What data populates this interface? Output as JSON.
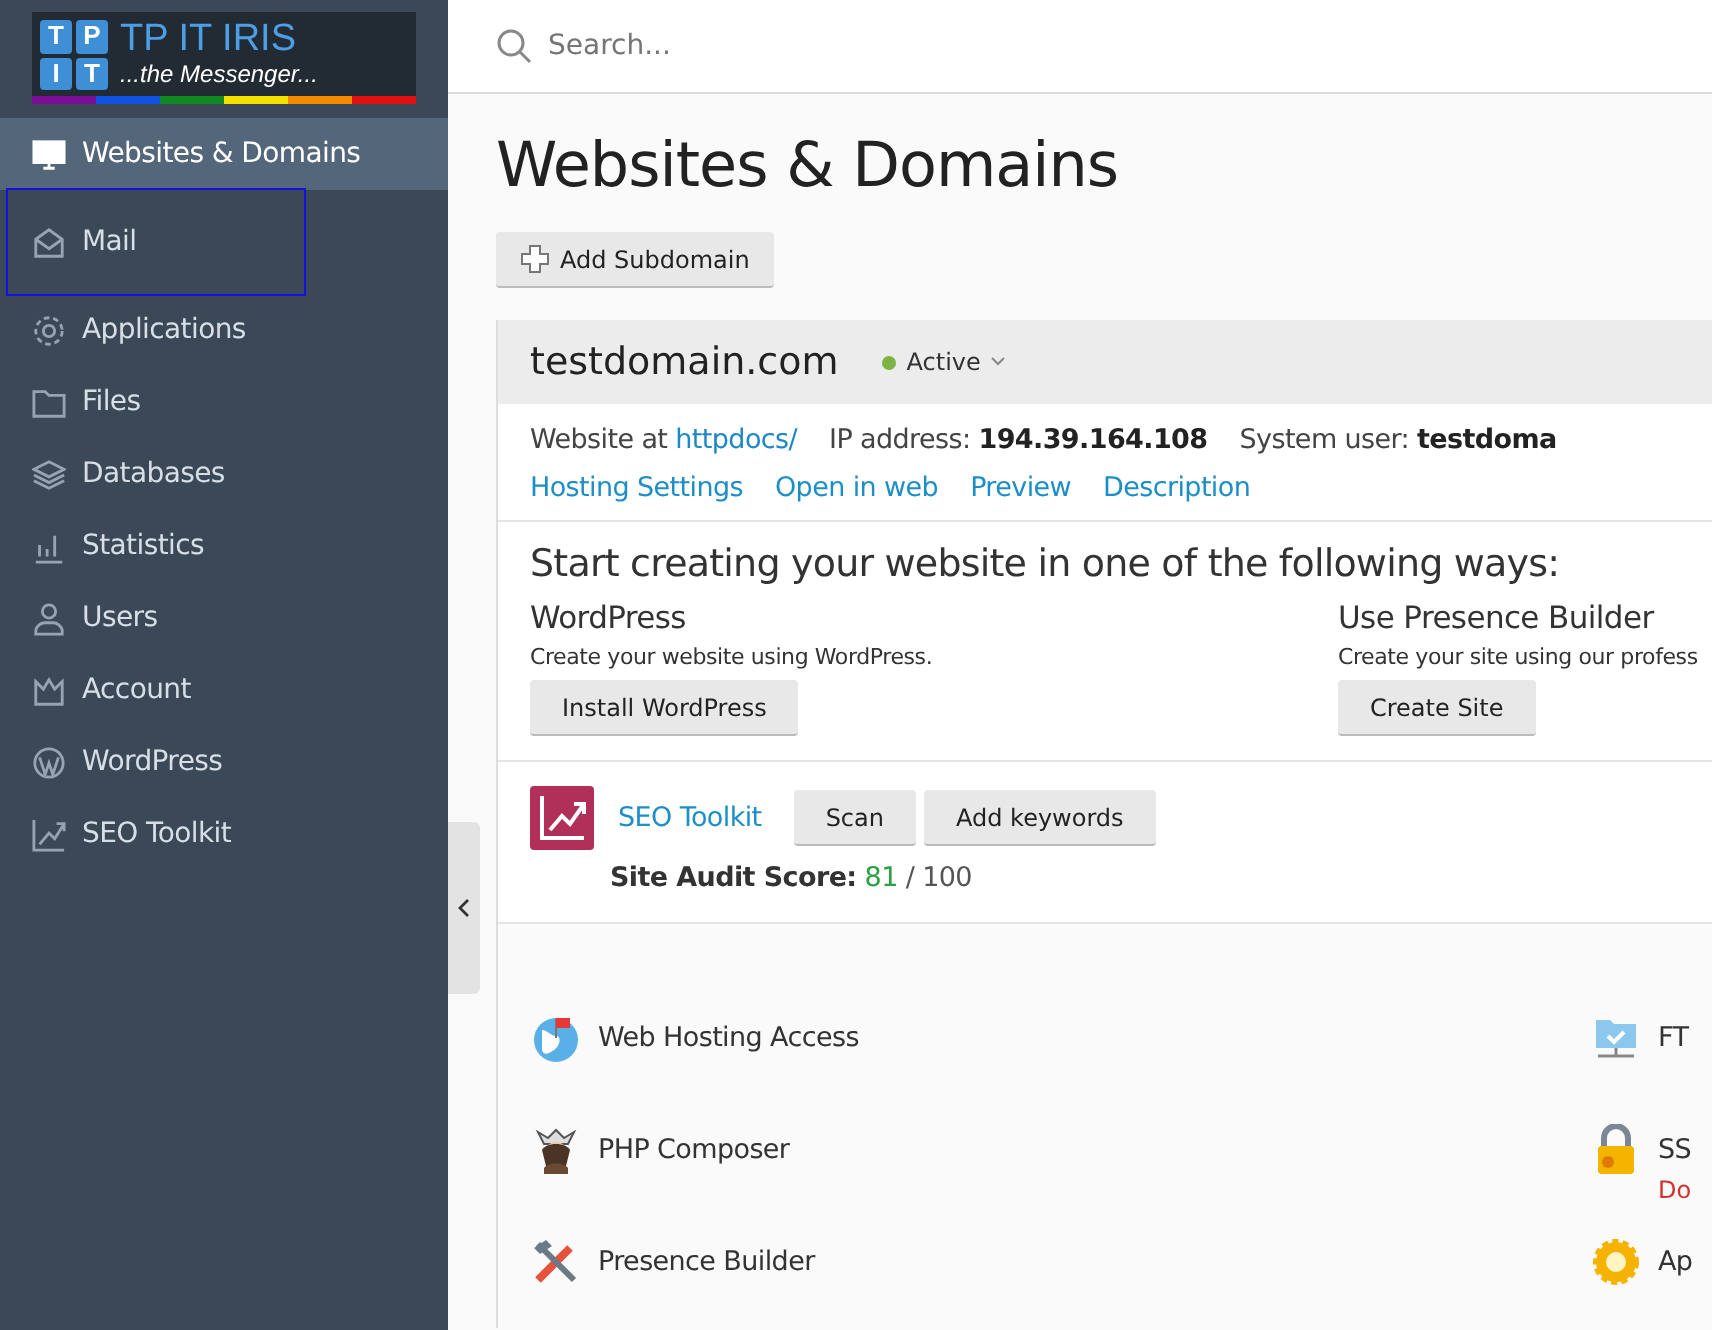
{
  "logo": {
    "letters": [
      "T",
      "P",
      "I",
      "T"
    ],
    "title": "TP IT IRIS",
    "tagline": "...the Messenger..."
  },
  "sidebar": {
    "items": [
      {
        "label": "Websites & Domains",
        "selected": true,
        "focused": false
      },
      {
        "label": "Mail",
        "selected": false,
        "focused": true
      },
      {
        "label": "Applications",
        "selected": false,
        "focused": false
      },
      {
        "label": "Files",
        "selected": false,
        "focused": false
      },
      {
        "label": "Databases",
        "selected": false,
        "focused": false
      },
      {
        "label": "Statistics",
        "selected": false,
        "focused": false
      },
      {
        "label": "Users",
        "selected": false,
        "focused": false
      },
      {
        "label": "Account",
        "selected": false,
        "focused": false
      },
      {
        "label": "WordPress",
        "selected": false,
        "focused": false
      },
      {
        "label": "SEO Toolkit",
        "selected": false,
        "focused": false
      }
    ]
  },
  "search": {
    "placeholder": "Search..."
  },
  "page": {
    "title": "Websites & Domains",
    "add_button": "Add Subdomain"
  },
  "domain": {
    "name": "testdomain.com",
    "status": "Active",
    "info": [
      {
        "label": "Website at",
        "value": "httpdocs/",
        "kind": "link"
      },
      {
        "label": "IP address:",
        "value": "194.39.164.108",
        "kind": "bold"
      },
      {
        "label": "System user:",
        "value": "testdoma",
        "kind": "bold"
      }
    ],
    "links": [
      "Hosting Settings",
      "Open in web",
      "Preview",
      "Description"
    ],
    "start": {
      "heading": "Start creating your website in one of the following ways:",
      "options": [
        {
          "title": "WordPress",
          "description": "Create your website using WordPress.",
          "button": "Install WordPress"
        },
        {
          "title": "Use Presence Builder",
          "description": "Create your site using our profess",
          "button": "Create Site"
        }
      ]
    },
    "seo": {
      "name": "SEO Toolkit",
      "buttons": [
        "Scan",
        "Add keywords"
      ],
      "score_label": "Site Audit Score:",
      "score": "81",
      "max": "/ 100"
    },
    "tools": [
      {
        "label": "Web Hosting Access"
      },
      {
        "label": "FT"
      },
      {
        "label": "PHP Composer"
      },
      {
        "label": "SS",
        "note": "Do"
      },
      {
        "label": "Presence Builder"
      },
      {
        "label": "Ap"
      }
    ]
  }
}
